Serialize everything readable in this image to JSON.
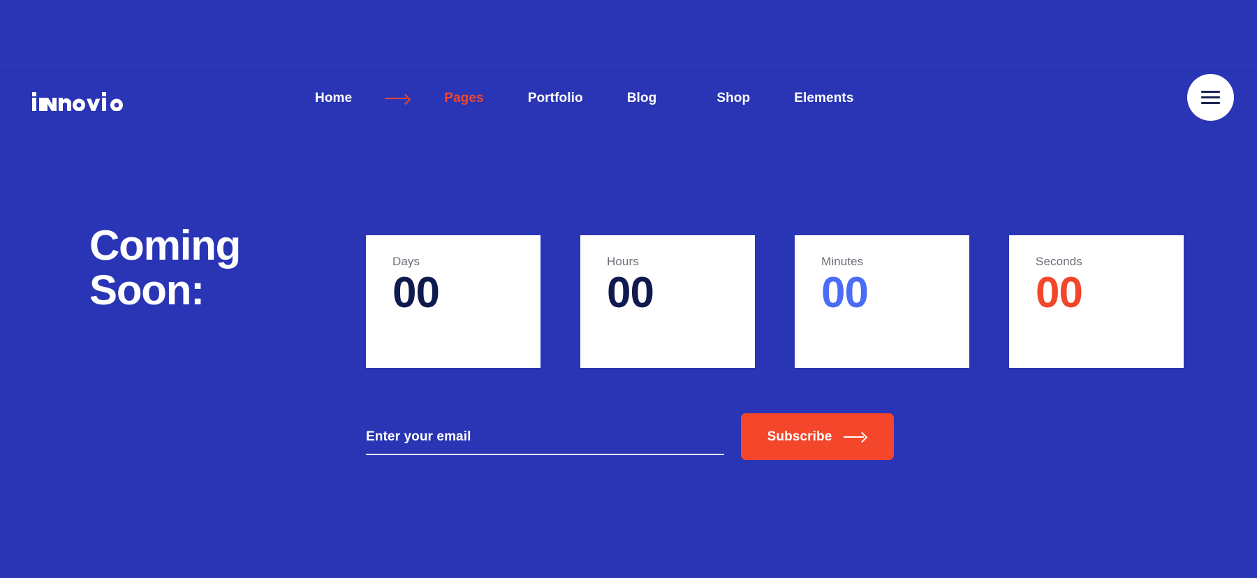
{
  "theme": {
    "background": "#2a35b5",
    "accent": "#f4462a",
    "card_background": "#ffffff",
    "navy": "#101a4e",
    "blue": "#4a6cf7",
    "muted_text": "#6d6d78"
  },
  "header": {
    "brand": {
      "name": "innovio",
      "letters": "innovio"
    },
    "nav": [
      {
        "label": "Home",
        "active": false
      },
      {
        "label": "Pages",
        "active": true
      },
      {
        "label": "Portfolio",
        "active": false
      },
      {
        "label": "Blog",
        "active": false
      },
      {
        "label": "Shop",
        "active": false
      },
      {
        "label": "Elements",
        "active": false
      }
    ],
    "menu_toggle": {
      "icon": "hamburger-menu-icon"
    },
    "pointer_icon": "arrow-right-icon"
  },
  "hero": {
    "headline": "Coming\nSoon:"
  },
  "countdown": [
    {
      "label": "Days",
      "value": "00",
      "tone": "navy"
    },
    {
      "label": "Hours",
      "value": "00",
      "tone": "navy"
    },
    {
      "label": "Minutes",
      "value": "00",
      "tone": "blue"
    },
    {
      "label": "Seconds",
      "value": "00",
      "tone": "orange"
    }
  ],
  "subscribe": {
    "email_placeholder": "Enter your email",
    "email_value": "",
    "button_label": "Subscribe",
    "button_icon": "arrow-right-icon"
  }
}
